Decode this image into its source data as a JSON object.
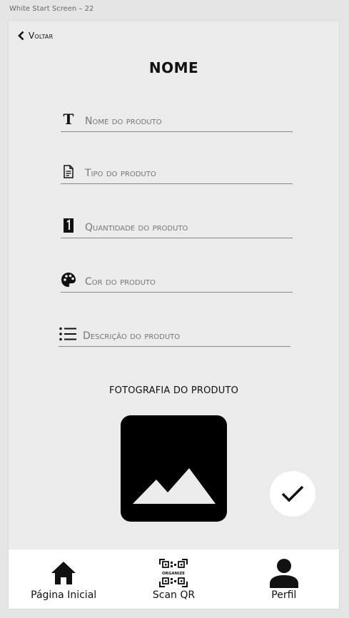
{
  "frame_title": "White Start Screen – 22",
  "header": {
    "back_label": "Voltar",
    "title": "NOME"
  },
  "form": {
    "fields": [
      {
        "placeholder": "Nome do produto",
        "icon": "text-icon"
      },
      {
        "placeholder": "Tipo do produto",
        "icon": "document-icon"
      },
      {
        "placeholder": "Quantidade do produto",
        "icon": "number-one-icon"
      },
      {
        "placeholder": "Cor do produto",
        "icon": "palette-icon"
      },
      {
        "placeholder": "Descrição do produto",
        "icon": "list-icon"
      }
    ],
    "photo_label": "FOTOGRAFIA DO PRODUTO",
    "photo_icon": "image-icon",
    "confirm_icon": "check-icon"
  },
  "bottom_nav": {
    "items": [
      {
        "label": "Página Inicial",
        "icon": "home-icon"
      },
      {
        "label": "Scan QR",
        "icon": "qr-code-icon",
        "icon_text": "ORGANIZE"
      },
      {
        "label": "Perfil",
        "icon": "user-icon"
      }
    ]
  }
}
